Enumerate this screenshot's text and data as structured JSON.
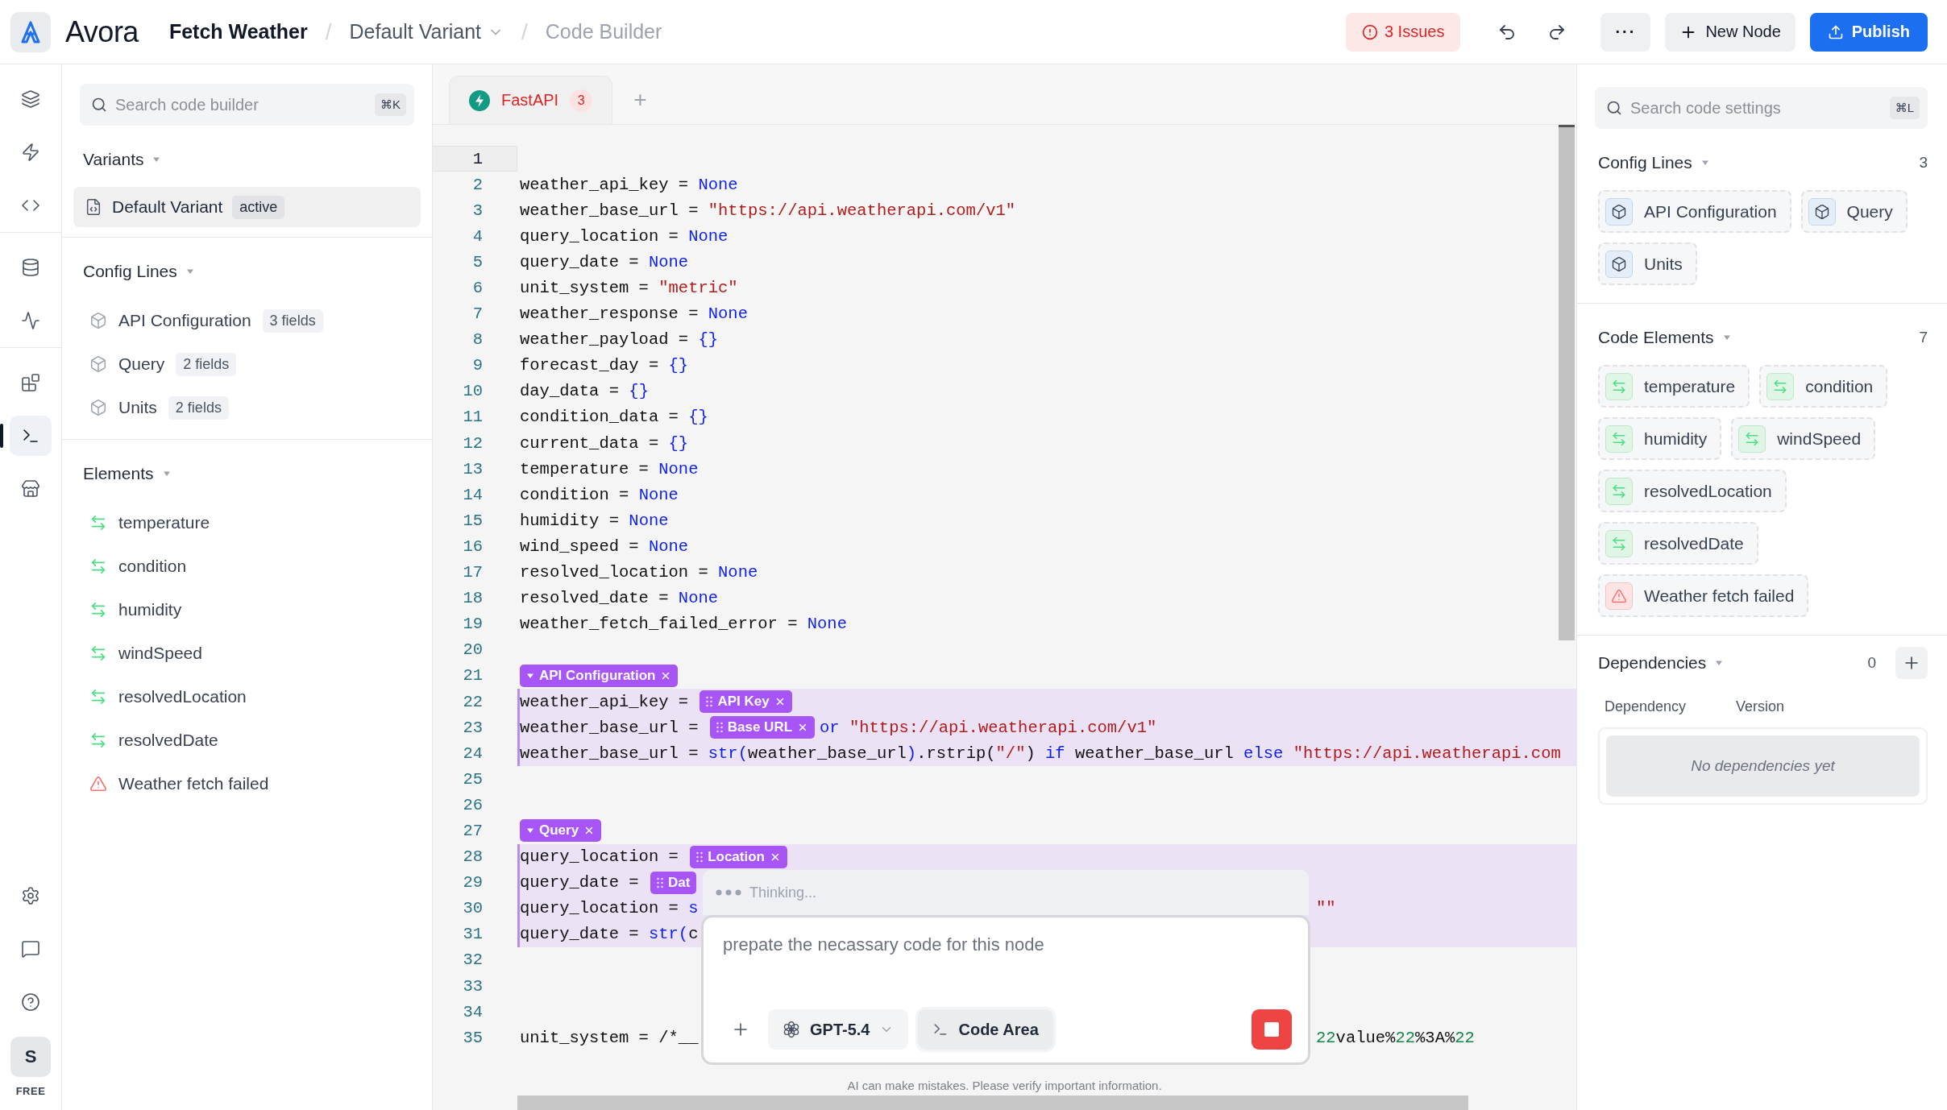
{
  "topbar": {
    "app_name": "Avora",
    "breadcrumbs": [
      {
        "label": "Fetch Weather",
        "kind": "link"
      },
      {
        "separator": "/",
        "label": "Default Variant",
        "kind": "dropdown"
      },
      {
        "separator": "/",
        "label": "Code Builder",
        "kind": "current"
      }
    ],
    "issues": "3 Issues",
    "more": "···",
    "new_node": "New Node",
    "publish": "Publish"
  },
  "rail": {
    "groups": [
      [
        {
          "kind": "layers",
          "selected": false
        },
        {
          "kind": "zap",
          "selected": false
        },
        {
          "kind": "code",
          "selected": false
        }
      ],
      [
        {
          "kind": "database",
          "selected": false
        },
        {
          "kind": "activity",
          "selected": false
        }
      ],
      [
        {
          "kind": "blocks",
          "selected": false
        },
        {
          "kind": "terminal",
          "selected": true
        },
        {
          "kind": "store",
          "selected": false
        }
      ]
    ],
    "bottom": [
      {
        "kind": "settings",
        "selected": false
      },
      {
        "kind": "message",
        "selected": false
      },
      {
        "kind": "help",
        "selected": false
      }
    ],
    "avatar": "S",
    "plan": "FREE"
  },
  "left_panel": {
    "search": {
      "placeholder": "Search code builder",
      "shortcut": "⌘K"
    },
    "variants": {
      "title": "Variants",
      "expanded": true,
      "items": [
        {
          "label": "Default Variant",
          "badge": "active",
          "selected": true
        }
      ]
    },
    "config_lines": {
      "title": "Config Lines",
      "expanded": true,
      "items": [
        {
          "label": "API Configuration",
          "badge": "3 fields"
        },
        {
          "label": "Query",
          "badge": "2 fields"
        },
        {
          "label": "Units",
          "badge": "2 fields"
        }
      ]
    },
    "elements": {
      "title": "Elements",
      "expanded": true,
      "items": [
        {
          "label": "temperature",
          "kind": "mapping"
        },
        {
          "label": "condition",
          "kind": "mapping"
        },
        {
          "label": "humidity",
          "kind": "mapping"
        },
        {
          "label": "windSpeed",
          "kind": "mapping"
        },
        {
          "label": "resolvedLocation",
          "kind": "mapping"
        },
        {
          "label": "resolvedDate",
          "kind": "mapping"
        },
        {
          "label": "Weather fetch failed",
          "kind": "error"
        }
      ]
    }
  },
  "editor": {
    "tabs": [
      {
        "label": "FastAPI",
        "badge": "3",
        "selected": true
      }
    ],
    "add_tab": "+",
    "lines": [
      {
        "n": "1",
        "active": true,
        "highlight": false
      },
      {
        "n": "2",
        "active": false,
        "highlight": false,
        "segs": [
          {
            "kind": "plain",
            "text": "weather_api_key = "
          },
          {
            "kind": "kw",
            "text": "None"
          }
        ]
      },
      {
        "n": "3",
        "active": false,
        "highlight": false,
        "segs": [
          {
            "kind": "plain",
            "text": "weather_base_url = "
          },
          {
            "kind": "str",
            "text": "\"https://api.weatherapi.com/v1\""
          }
        ]
      },
      {
        "n": "4",
        "active": false,
        "highlight": false,
        "segs": [
          {
            "kind": "plain",
            "text": "query_location = "
          },
          {
            "kind": "kw",
            "text": "None"
          }
        ]
      },
      {
        "n": "5",
        "active": false,
        "highlight": false,
        "segs": [
          {
            "kind": "plain",
            "text": "query_date = "
          },
          {
            "kind": "kw",
            "text": "None"
          }
        ]
      },
      {
        "n": "6",
        "active": false,
        "highlight": false,
        "segs": [
          {
            "kind": "plain",
            "text": "unit_system = "
          },
          {
            "kind": "str",
            "text": "\"metric\""
          }
        ]
      },
      {
        "n": "7",
        "active": false,
        "highlight": false,
        "segs": [
          {
            "kind": "plain",
            "text": "weather_response = "
          },
          {
            "kind": "kw",
            "text": "None"
          }
        ]
      },
      {
        "n": "8",
        "active": false,
        "highlight": false,
        "segs": [
          {
            "kind": "plain",
            "text": "weather_payload = "
          },
          {
            "kind": "kw",
            "text": "{}"
          }
        ]
      },
      {
        "n": "9",
        "active": false,
        "highlight": false,
        "segs": [
          {
            "kind": "plain",
            "text": "forecast_day = "
          },
          {
            "kind": "kw",
            "text": "{}"
          }
        ]
      },
      {
        "n": "10",
        "active": false,
        "highlight": false,
        "segs": [
          {
            "kind": "plain",
            "text": "day_data = "
          },
          {
            "kind": "kw",
            "text": "{}"
          }
        ]
      },
      {
        "n": "11",
        "active": false,
        "highlight": false,
        "segs": [
          {
            "kind": "plain",
            "text": "condition_data = "
          },
          {
            "kind": "kw",
            "text": "{}"
          }
        ]
      },
      {
        "n": "12",
        "active": false,
        "highlight": false,
        "segs": [
          {
            "kind": "plain",
            "text": "current_data = "
          },
          {
            "kind": "kw",
            "text": "{}"
          }
        ]
      },
      {
        "n": "13",
        "active": false,
        "highlight": false,
        "segs": [
          {
            "kind": "plain",
            "text": "temperature = "
          },
          {
            "kind": "kw",
            "text": "None"
          }
        ]
      },
      {
        "n": "14",
        "active": false,
        "highlight": false,
        "segs": [
          {
            "kind": "plain",
            "text": "condition = "
          },
          {
            "kind": "kw",
            "text": "None"
          }
        ]
      },
      {
        "n": "15",
        "active": false,
        "highlight": false,
        "segs": [
          {
            "kind": "plain",
            "text": "humidity = "
          },
          {
            "kind": "kw",
            "text": "None"
          }
        ]
      },
      {
        "n": "16",
        "active": false,
        "highlight": false,
        "segs": [
          {
            "kind": "plain",
            "text": "wind_speed = "
          },
          {
            "kind": "kw",
            "text": "None"
          }
        ]
      },
      {
        "n": "17",
        "active": false,
        "highlight": false,
        "segs": [
          {
            "kind": "plain",
            "text": "resolved_location = "
          },
          {
            "kind": "kw",
            "text": "None"
          }
        ]
      },
      {
        "n": "18",
        "active": false,
        "highlight": false,
        "segs": [
          {
            "kind": "plain",
            "text": "resolved_date = "
          },
          {
            "kind": "kw",
            "text": "None"
          }
        ]
      },
      {
        "n": "19",
        "active": false,
        "highlight": false,
        "segs": [
          {
            "kind": "plain",
            "text": "weather_fetch_failed_error = "
          },
          {
            "kind": "kw",
            "text": "None"
          }
        ]
      },
      {
        "n": "20",
        "active": false,
        "highlight": false
      },
      {
        "n": "21",
        "active": false,
        "highlight": false,
        "segs": [
          {
            "kind": "group",
            "text": "API Configuration",
            "expanded": true
          }
        ]
      },
      {
        "n": "22",
        "active": false,
        "highlight": true,
        "segs": [
          {
            "kind": "plain",
            "text": "weather_api_key = "
          },
          {
            "kind": "chip",
            "text": "API Key",
            "closable": true
          }
        ]
      },
      {
        "n": "23",
        "active": false,
        "highlight": true,
        "segs": [
          {
            "kind": "plain",
            "text": "weather_base_url = "
          },
          {
            "kind": "chip",
            "text": "Base URL",
            "closable": true
          },
          {
            "kind": "kw",
            "text": "or "
          },
          {
            "kind": "str",
            "text": "\"https://api.weatherapi.com/v1\""
          }
        ]
      },
      {
        "n": "24",
        "active": false,
        "highlight": true,
        "segs": [
          {
            "kind": "plain",
            "text": "weather_base_url = "
          },
          {
            "kind": "kw",
            "text": "str("
          },
          {
            "kind": "plain",
            "text": "weather_base_url"
          },
          {
            "kind": "kw",
            "text": ")"
          },
          {
            "kind": "plain",
            "text": ".rstrip("
          },
          {
            "kind": "str",
            "text": "\"/\""
          },
          {
            "kind": "plain",
            "text": ") "
          },
          {
            "kind": "kw",
            "text": "if "
          },
          {
            "kind": "plain",
            "text": "weather_base_url "
          },
          {
            "kind": "kw",
            "text": "else "
          },
          {
            "kind": "str",
            "text": "\"https://api.weatherapi.com"
          }
        ]
      },
      {
        "n": "25",
        "active": false,
        "highlight": false
      },
      {
        "n": "26",
        "active": false,
        "highlight": false
      },
      {
        "n": "27",
        "active": false,
        "highlight": false,
        "segs": [
          {
            "kind": "group",
            "text": "Query",
            "expanded": true
          }
        ]
      },
      {
        "n": "28",
        "active": false,
        "highlight": true,
        "segs": [
          {
            "kind": "plain",
            "text": "query_location = "
          },
          {
            "kind": "chip",
            "text": "Location",
            "closable": true
          }
        ]
      },
      {
        "n": "29",
        "active": false,
        "highlight": true,
        "segs": [
          {
            "kind": "plain",
            "text": "query_date = "
          },
          {
            "kind": "chip",
            "text": "Dat",
            "closable": false
          }
        ]
      },
      {
        "n": "30",
        "active": false,
        "highlight": true,
        "segs": [
          {
            "kind": "plain",
            "text": "query_location = "
          },
          {
            "kind": "kw",
            "text": "s"
          }
        ],
        "tail": [
          {
            "kind": "str",
            "text": "\"\""
          }
        ]
      },
      {
        "n": "31",
        "active": false,
        "highlight": true,
        "segs": [
          {
            "kind": "plain",
            "text": "query_date = "
          },
          {
            "kind": "kw",
            "text": "str("
          },
          {
            "kind": "plain",
            "text": "c"
          }
        ]
      },
      {
        "n": "32",
        "active": false,
        "highlight": false
      },
      {
        "n": "33",
        "active": false,
        "highlight": false
      },
      {
        "n": "34",
        "active": false,
        "highlight": false
      },
      {
        "n": "35",
        "active": false,
        "highlight": false,
        "segs": [
          {
            "kind": "plain",
            "text": "unit_system = /*__"
          }
        ],
        "tail": [
          {
            "kind": "num",
            "text": "22"
          },
          {
            "kind": "plain",
            "text": "value%"
          },
          {
            "kind": "num",
            "text": "22"
          },
          {
            "kind": "plain",
            "text": "%3A%"
          },
          {
            "kind": "num",
            "text": "22"
          }
        ]
      }
    ],
    "assistant": {
      "status": "Thinking...",
      "prompt": "prepate the necassary code for this node",
      "model": "GPT-5.4",
      "context": "Code Area",
      "running": true
    },
    "disclaimer": "AI can make mistakes. Please verify important information."
  },
  "right_panel": {
    "search": {
      "placeholder": "Search code settings",
      "shortcut": "⌘L"
    },
    "config_lines": {
      "title": "Config Lines",
      "count": "3",
      "expanded": true,
      "items": [
        {
          "label": "API Configuration",
          "kind": "config"
        },
        {
          "label": "Query",
          "kind": "config"
        },
        {
          "label": "Units",
          "kind": "config"
        }
      ]
    },
    "code_elements": {
      "title": "Code Elements",
      "count": "7",
      "expanded": true,
      "items": [
        {
          "label": "temperature",
          "kind": "mapping"
        },
        {
          "label": "condition",
          "kind": "mapping"
        },
        {
          "label": "humidity",
          "kind": "mapping"
        },
        {
          "label": "windSpeed",
          "kind": "mapping"
        },
        {
          "label": "resolvedLocation",
          "kind": "mapping"
        },
        {
          "label": "resolvedDate",
          "kind": "mapping"
        },
        {
          "label": "Weather fetch failed",
          "kind": "error"
        }
      ]
    },
    "dependencies": {
      "title": "Dependencies",
      "count": "0",
      "expanded": true,
      "columns": [
        "Dependency",
        "Version"
      ],
      "empty": "No dependencies yet"
    }
  }
}
